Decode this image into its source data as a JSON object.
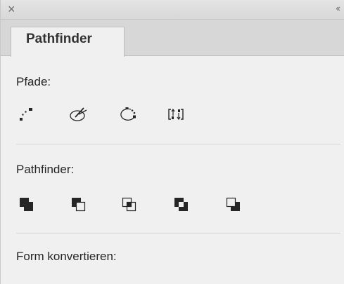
{
  "header": {
    "close_glyph": "×",
    "collapse_glyph": "‹‹"
  },
  "tabs": [
    {
      "label": "Pathfinder",
      "active": true
    }
  ],
  "sections": {
    "paths": {
      "label": "Pfade:",
      "icons": [
        "join-path-icon",
        "trim-path-icon",
        "extend-path-icon",
        "reverse-path-icon"
      ]
    },
    "pathfinder": {
      "label": "Pathfinder:",
      "icons": [
        "unite-icon",
        "minus-front-icon",
        "intersect-icon",
        "exclude-icon",
        "minus-back-icon"
      ]
    },
    "convert_shape": {
      "label": "Form konvertieren:"
    }
  },
  "colors": {
    "icon_dark": "#262626",
    "background": "#f0f0f0",
    "tabstrip": "#d7d7d7"
  }
}
